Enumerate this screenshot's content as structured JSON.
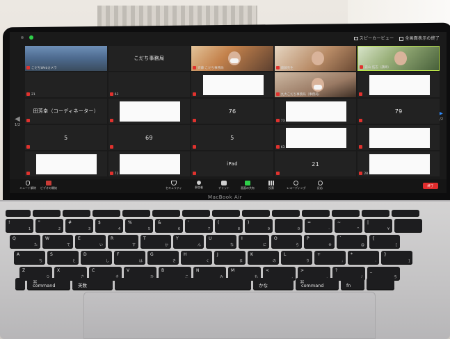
{
  "view_switch": {
    "speaker_view": "スピーカービュー",
    "fullscreen": "全画面表示の終了"
  },
  "grid": {
    "tiles": [
      {
        "name": "",
        "label": "こだちWebカメラ",
        "kind": "video-a"
      },
      {
        "name": "こだち事務局",
        "label": "",
        "kind": "name"
      },
      {
        "name": "",
        "label": "斉藤 こだち事務局",
        "kind": "video-b"
      },
      {
        "name": "",
        "label": "齋藤先生",
        "kind": "video-c"
      },
      {
        "name": "",
        "label": "森山 拓志（講師）",
        "kind": "video-d"
      },
      {
        "name": "",
        "label": "21",
        "kind": "blank"
      },
      {
        "name": "",
        "label": "63",
        "kind": "blank"
      },
      {
        "name": "",
        "label": "",
        "kind": "white"
      },
      {
        "name": "",
        "label": "九大こだち事務局（事務局）",
        "kind": "video-e"
      },
      {
        "name": "",
        "label": "",
        "kind": "white"
      },
      {
        "name": "田芳幸（コーディネーター）",
        "label": "",
        "kind": "name"
      },
      {
        "name": "",
        "label": "",
        "kind": "white"
      },
      {
        "name": "76",
        "label": "",
        "kind": "name"
      },
      {
        "name": "",
        "label": "73",
        "kind": "white"
      },
      {
        "name": "79",
        "label": "",
        "kind": "name"
      },
      {
        "name": "5",
        "label": "",
        "kind": "name"
      },
      {
        "name": "69",
        "label": "",
        "kind": "name"
      },
      {
        "name": "5",
        "label": "",
        "kind": "name"
      },
      {
        "name": "",
        "label": "63",
        "kind": "white"
      },
      {
        "name": "",
        "label": "",
        "kind": "white"
      },
      {
        "name": "",
        "label": "",
        "kind": "white"
      },
      {
        "name": "",
        "label": "72",
        "kind": "white"
      },
      {
        "name": "iPad",
        "label": "",
        "kind": "name"
      },
      {
        "name": "21",
        "label": "",
        "kind": "name"
      },
      {
        "name": "",
        "label": "28",
        "kind": "white"
      }
    ]
  },
  "paging": {
    "left": "1/2",
    "right": "1/2"
  },
  "toolbar": {
    "mute": "ミュート解除",
    "video": "ビデオの開始",
    "security": "セキュリティ",
    "participants": "参加者",
    "chat": "チャット",
    "share": "画面の共有",
    "polls": "投票",
    "record": "レコーディング",
    "reactions": "反応",
    "end": "終了"
  },
  "brand": "MacBook Air",
  "keyboard": {
    "row1": [
      [
        "!",
        "1"
      ],
      [
        "\"",
        "2"
      ],
      [
        "#",
        "3"
      ],
      [
        "$",
        "4"
      ],
      [
        "%",
        "5"
      ],
      [
        "&",
        "6"
      ],
      [
        "'",
        "7"
      ],
      [
        "(",
        "8"
      ],
      [
        ")",
        "9"
      ],
      [
        "",
        "0"
      ],
      [
        "=",
        "-"
      ],
      [
        "~",
        "^"
      ],
      [
        "|",
        "¥"
      ],
      [
        "",
        ""
      ]
    ],
    "row2": [
      [
        "Q",
        "た"
      ],
      [
        "W",
        "て"
      ],
      [
        "E",
        "い"
      ],
      [
        "R",
        "す"
      ],
      [
        "T",
        "か"
      ],
      [
        "Y",
        "ん"
      ],
      [
        "U",
        "な"
      ],
      [
        "I",
        "に"
      ],
      [
        "O",
        "ら"
      ],
      [
        "P",
        "せ"
      ],
      [
        "`",
        "@"
      ],
      [
        "{",
        "["
      ]
    ],
    "row3": [
      [
        "A",
        "ち"
      ],
      [
        "S",
        "と"
      ],
      [
        "D",
        "し"
      ],
      [
        "F",
        "は"
      ],
      [
        "G",
        "き"
      ],
      [
        "H",
        "く"
      ],
      [
        "J",
        "ま"
      ],
      [
        "K",
        "の"
      ],
      [
        "L",
        "り"
      ],
      [
        "+",
        ";"
      ],
      [
        "*",
        ":"
      ],
      [
        "}",
        "]"
      ]
    ],
    "row4": [
      [
        "Z",
        "つ"
      ],
      [
        "X",
        "さ"
      ],
      [
        "C",
        "そ"
      ],
      [
        "V",
        "ひ"
      ],
      [
        "B",
        "こ"
      ],
      [
        "N",
        "み"
      ],
      [
        "M",
        "も"
      ],
      [
        "<",
        ","
      ],
      [
        ">",
        "."
      ],
      [
        "?",
        "/"
      ],
      [
        "_",
        "ろ"
      ]
    ],
    "row5": {
      "command_left": "command",
      "eisu": "英数",
      "kana": "かな",
      "command_right": "command",
      "fn": "fn",
      "symbol": "⌘"
    }
  },
  "colors": {
    "end": "#e02d2d",
    "share": "#2fcf4a",
    "active_border": "#b9e34a",
    "page_arrow": "#2e8cff"
  }
}
